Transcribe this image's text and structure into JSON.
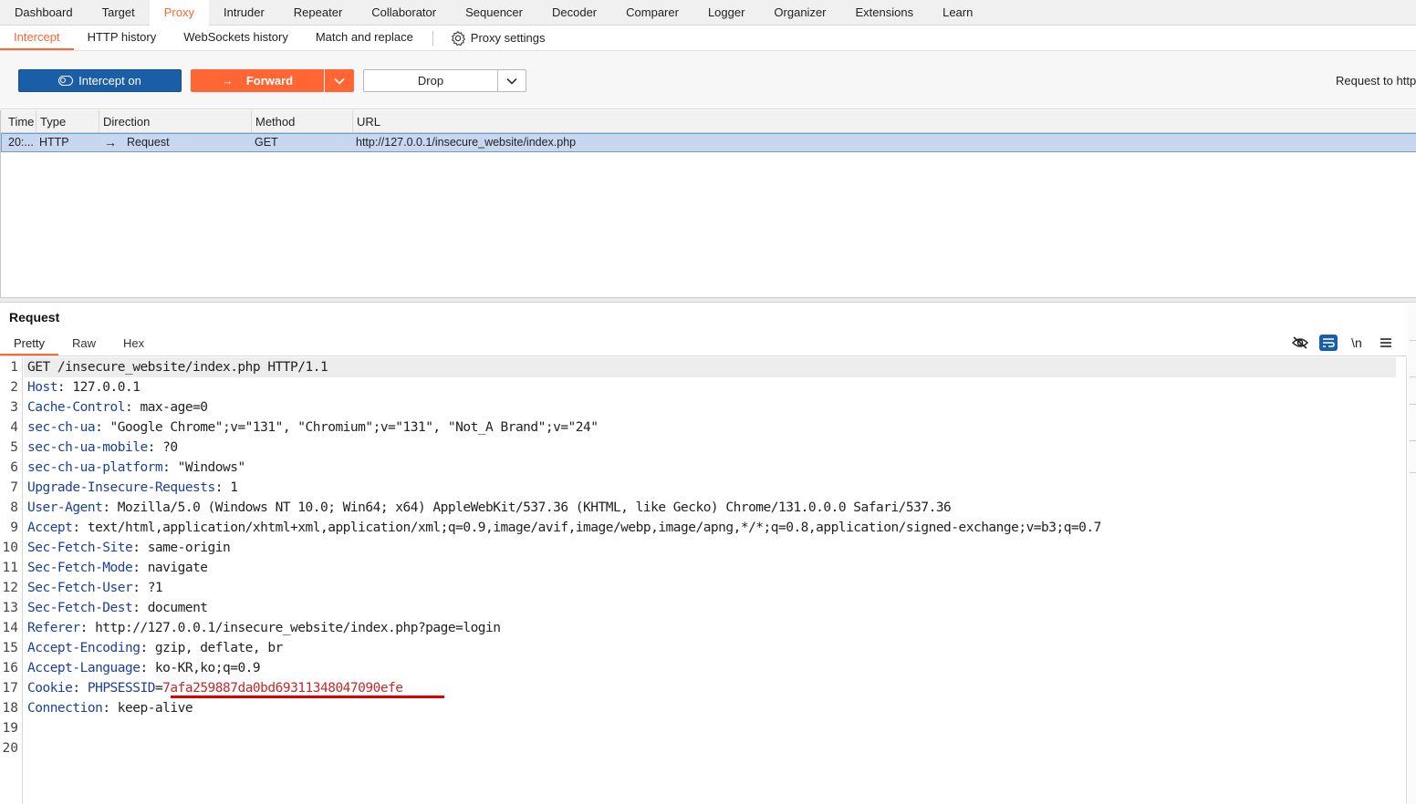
{
  "top_tabs": [
    "Dashboard",
    "Target",
    "Proxy",
    "Intruder",
    "Repeater",
    "Collaborator",
    "Sequencer",
    "Decoder",
    "Comparer",
    "Logger",
    "Organizer",
    "Extensions",
    "Learn"
  ],
  "active_top_tab": "Proxy",
  "sub_tabs": {
    "intercept": "Intercept",
    "http_history": "HTTP history",
    "websockets_history": "WebSockets history",
    "match_replace": "Match and replace",
    "proxy_settings": "Proxy settings"
  },
  "toolbar": {
    "intercept_label": "Intercept on",
    "forward_label": "Forward",
    "drop_label": "Drop",
    "request_to": "Request to http"
  },
  "table": {
    "headers": {
      "time": "Time",
      "type": "Type",
      "direction": "Direction",
      "method": "Method",
      "url": "URL"
    },
    "row": {
      "time": "20:...",
      "type": "HTTP",
      "direction": "Request",
      "method": "GET",
      "url": "http://127.0.0.1/insecure_website/index.php"
    }
  },
  "request_panel": {
    "title": "Request",
    "tabs": {
      "pretty": "Pretty",
      "raw": "Raw",
      "hex": "Hex"
    },
    "newline_toggle": "\\n"
  },
  "request_lines": [
    {
      "n": "1",
      "key": "",
      "sep": "",
      "val": "GET /insecure_website/index.php HTTP/1.1"
    },
    {
      "n": "2",
      "key": "Host",
      "sep": ": ",
      "val": "127.0.0.1"
    },
    {
      "n": "3",
      "key": "Cache-Control",
      "sep": ": ",
      "val": "max-age=0"
    },
    {
      "n": "4",
      "key": "sec-ch-ua",
      "sep": ": ",
      "val": "\"Google Chrome\";v=\"131\", \"Chromium\";v=\"131\", \"Not_A Brand\";v=\"24\""
    },
    {
      "n": "5",
      "key": "sec-ch-ua-mobile",
      "sep": ": ",
      "val": "?0"
    },
    {
      "n": "6",
      "key": "sec-ch-ua-platform",
      "sep": ": ",
      "val": "\"Windows\""
    },
    {
      "n": "7",
      "key": "Upgrade-Insecure-Requests",
      "sep": ": ",
      "val": "1"
    },
    {
      "n": "8",
      "key": "User-Agent",
      "sep": ": ",
      "val": "Mozilla/5.0 (Windows NT 10.0; Win64; x64) AppleWebKit/537.36 (KHTML, like Gecko) Chrome/131.0.0.0 Safari/537.36"
    },
    {
      "n": "9",
      "key": "Accept",
      "sep": ": ",
      "val": "text/html,application/xhtml+xml,application/xml;q=0.9,image/avif,image/webp,image/apng,*/*;q=0.8,application/signed-exchange;v=b3;q=0.7"
    },
    {
      "n": "10",
      "key": "Sec-Fetch-Site",
      "sep": ": ",
      "val": "same-origin"
    },
    {
      "n": "11",
      "key": "Sec-Fetch-Mode",
      "sep": ": ",
      "val": "navigate"
    },
    {
      "n": "12",
      "key": "Sec-Fetch-User",
      "sep": ": ",
      "val": "?1"
    },
    {
      "n": "13",
      "key": "Sec-Fetch-Dest",
      "sep": ": ",
      "val": "document"
    },
    {
      "n": "14",
      "key": "Referer",
      "sep": ": ",
      "val": "http://127.0.0.1/insecure_website/index.php?page=login"
    },
    {
      "n": "15",
      "key": "Accept-Encoding",
      "sep": ": ",
      "val": "gzip, deflate, br"
    },
    {
      "n": "16",
      "key": "Accept-Language",
      "sep": ": ",
      "val": "ko-KR,ko;q=0.9"
    },
    {
      "n": "17",
      "key": "Cookie",
      "sep": ": ",
      "cookie_name": "PHPSESSID",
      "cookie_eq": "=",
      "cookie_val": "7afa259887da0bd69311348047090efe"
    },
    {
      "n": "18",
      "key": "Connection",
      "sep": ": ",
      "val": "keep-alive"
    },
    {
      "n": "19",
      "key": "",
      "sep": "",
      "val": ""
    },
    {
      "n": "20",
      "key": "",
      "sep": "",
      "val": ""
    }
  ],
  "colors": {
    "accent": "#ff6633",
    "primary": "#1b5ea8",
    "header_key": "#1b3f9e",
    "cookie_value": "#c62828",
    "annotation": "#e00000"
  }
}
